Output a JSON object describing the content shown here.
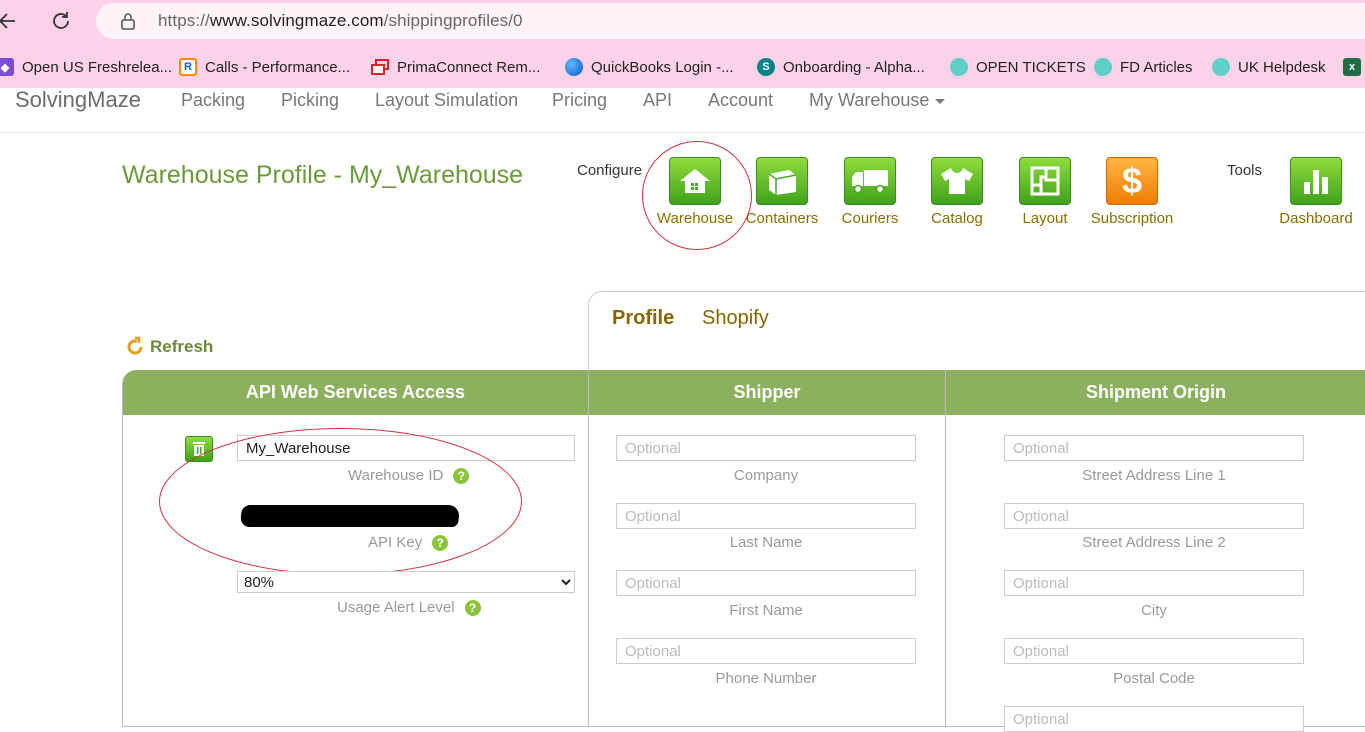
{
  "browser": {
    "url_prefix": "https://",
    "url_domain": "www.solvingmaze.com",
    "url_path": "/shippingprofiles/0",
    "bookmarks": [
      {
        "label": "Open US Freshrelea...",
        "icon": "freshrelease-icon",
        "color": "#7b4cd8"
      },
      {
        "label": "Calls - Performance...",
        "icon": "ringcentral-icon",
        "color": "#ff8800"
      },
      {
        "label": "PrimaConnect Rem...",
        "icon": "remote-window-icon",
        "color": "#d8232a"
      },
      {
        "label": "QuickBooks Login -...",
        "icon": "edge-globe-icon",
        "color": "#1a73e8"
      },
      {
        "label": "Onboarding - Alpha...",
        "icon": "sharepoint-icon",
        "color": "#038387"
      },
      {
        "label": "OPEN TICKETS",
        "icon": "freshdesk-icon",
        "color": "#25c16f"
      },
      {
        "label": "FD Articles",
        "icon": "freshdesk-icon",
        "color": "#25c16f"
      },
      {
        "label": "UK Helpdesk",
        "icon": "freshdesk-icon",
        "color": "#25c16f"
      }
    ]
  },
  "nav": {
    "brand": "SolvingMaze",
    "links": [
      "Packing",
      "Picking",
      "Layout Simulation",
      "Pricing",
      "API",
      "Account"
    ],
    "dropdown": "My Warehouse"
  },
  "header": {
    "title": "Warehouse Profile - My_Warehouse",
    "configure_label": "Configure",
    "tools_label": "Tools",
    "tiles": [
      "Warehouse",
      "Containers",
      "Couriers",
      "Catalog",
      "Layout",
      "Subscription"
    ],
    "dashboard": "Dashboard"
  },
  "tabs": {
    "profile": "Profile",
    "shopify": "Shopify"
  },
  "refresh": "Refresh",
  "api_section": {
    "title": "API Web Services Access",
    "warehouse_id_value": "My_Warehouse",
    "warehouse_id_label": "Warehouse ID",
    "api_key_label": "API Key",
    "alert_value": "80%",
    "alert_label": "Usage Alert Level",
    "help_glyph": "?"
  },
  "shipper": {
    "title": "Shipper",
    "placeholder": "Optional",
    "fields": [
      "Company",
      "Last Name",
      "First Name",
      "Phone Number"
    ]
  },
  "origin": {
    "title": "Shipment Origin",
    "placeholder": "Optional",
    "fields": [
      "Street Address Line 1",
      "Street Address Line 2",
      "City",
      "Postal Code"
    ]
  },
  "colors": {
    "accent_green": "#8cb05e",
    "title_green": "#6a9a3a",
    "tile_label": "#8a6d00",
    "annotation_red": "#d0303a"
  }
}
